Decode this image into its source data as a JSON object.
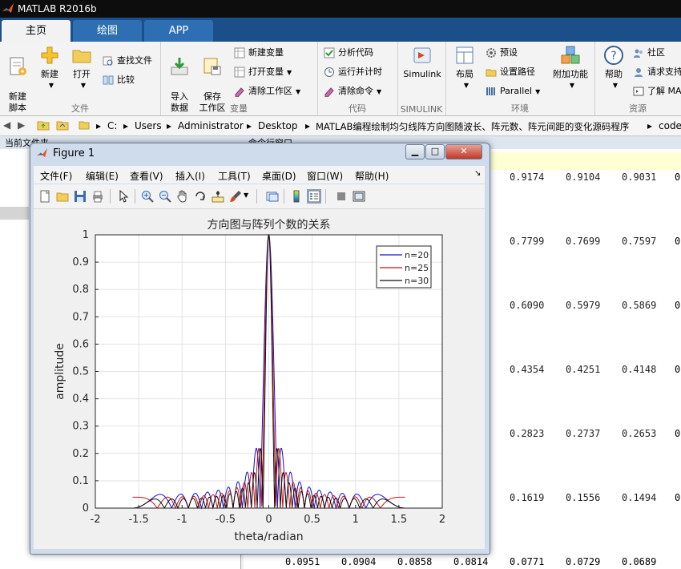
{
  "app": {
    "title": "MATLAB R2016b",
    "tabs": [
      "主页",
      "绘图",
      "APP"
    ]
  },
  "ribbon": {
    "file": {
      "label": "文件",
      "new_script": "新建\n脚本",
      "new": "新建",
      "open": "打开",
      "find_files": "查找文件",
      "compare": "比较"
    },
    "variable": {
      "label": "变量",
      "import": "导入\n数据",
      "save_ws": "保存\n工作区",
      "new_var": "新建变量",
      "open_var": "打开变量",
      "clear_ws": "清除工作区"
    },
    "code": {
      "label": "代码",
      "analyze": "分析代码",
      "run_time": "运行并计时",
      "clear_cmd": "清除命令"
    },
    "simulink": {
      "label": "SIMULINK",
      "simulink": "Simulink"
    },
    "env": {
      "label": "环境",
      "layout": "布局",
      "prefs": "预设",
      "set_path": "设置路径",
      "parallel": "Parallel",
      "addons": "附加功能"
    },
    "resources": {
      "label": "资源",
      "help": "帮助",
      "community": "社区",
      "request_support": "请求支持",
      "learn": "了解 MA"
    }
  },
  "address": {
    "crumbs": [
      "C:",
      "Users",
      "Administrator",
      "Desktop",
      "MATLAB编程绘制均匀线阵方向图随波长、阵元数、阵元间距的变化源码程序",
      "code"
    ]
  },
  "panels": {
    "current_folder": "当前文件夹",
    "command_window": "命令行窗口"
  },
  "command_output": {
    "rows": [
      [
        "0.9174",
        "0.9104",
        "0.9031"
      ],
      [
        "0.7799",
        "0.7699",
        "0.7597"
      ],
      [
        "0.6090",
        "0.5979",
        "0.5869"
      ],
      [
        "0.4354",
        "0.4251",
        "0.4148"
      ],
      [
        "0.2823",
        "0.2737",
        "0.2653"
      ],
      [
        "0.1619",
        "0.1556",
        "0.1494"
      ]
    ],
    "last_row": [
      "0.0951",
      "0.0904",
      "0.0858",
      "0.0814",
      "0.0771",
      "0.0729",
      "0.0689"
    ]
  },
  "figure": {
    "title": "Figure 1",
    "menu": [
      "文件(F)",
      "编辑(E)",
      "查看(V)",
      "插入(I)",
      "工具(T)",
      "桌面(D)",
      "窗口(W)",
      "帮助(H)"
    ],
    "toolbar_icons": [
      "new-figure-icon",
      "open-icon",
      "save-icon",
      "print-icon",
      "pointer-icon",
      "zoom-in-icon",
      "zoom-out-icon",
      "pan-icon",
      "rotate-icon",
      "data-cursor-icon",
      "brush-icon",
      "link-icon",
      "colorbar-icon",
      "legend-icon",
      "hide-plot-tools-icon",
      "show-plot-tools-icon"
    ]
  },
  "colors": {
    "n20": "#1010d0",
    "n25": "#d01010",
    "n30": "#111111",
    "ribbon_tab_bar": "#1b4f8a"
  },
  "chart_data": {
    "type": "line",
    "title": "方向图与阵列个数的关系",
    "xlabel": "theta/radian",
    "ylabel": "amplitude",
    "xlim": [
      -2,
      2
    ],
    "ylim": [
      0,
      1
    ],
    "xticks": [
      "-2",
      "-1.5",
      "-1",
      "-0.5",
      "0",
      "0.5",
      "1",
      "1.5",
      "2"
    ],
    "yticks": [
      "0",
      "0.1",
      "0.2",
      "0.3",
      "0.4",
      "0.5",
      "0.6",
      "0.7",
      "0.8",
      "0.9",
      "1"
    ],
    "grid": true,
    "legend_position": "top-right",
    "x_range": [
      -1.5708,
      1.5708
    ],
    "function": "|sin(n*pi*d*sin(theta))/(n*sin(pi*d*sin(theta)))|, d = 0.5",
    "series": [
      {
        "name": "n=20",
        "n": 20,
        "color": "#1010d0"
      },
      {
        "name": "n=25",
        "n": 25,
        "color": "#d01010"
      },
      {
        "name": "n=30",
        "n": 30,
        "color": "#111111"
      }
    ]
  }
}
